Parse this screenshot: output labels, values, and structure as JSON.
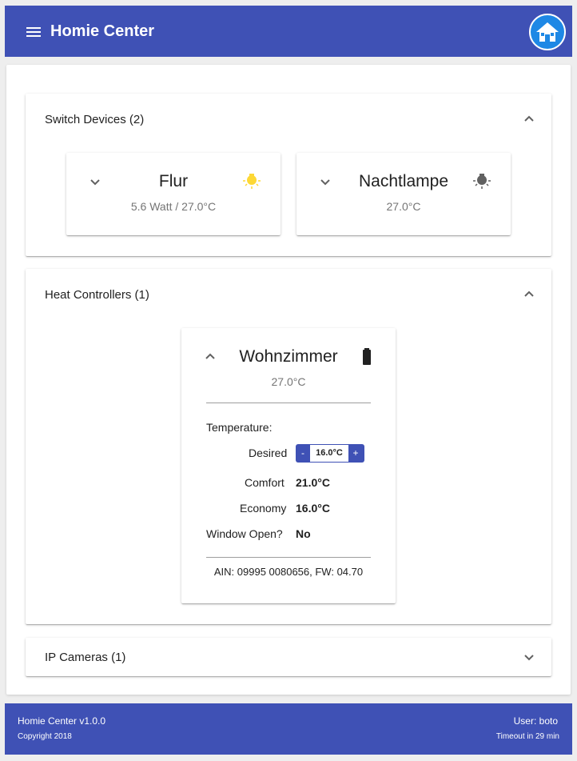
{
  "app": {
    "title": "Homie Center"
  },
  "colors": {
    "primary": "#3f51b5",
    "bulb_on": "#fdd835",
    "bulb_off": "#616161"
  },
  "panels": {
    "switch": {
      "title": "Switch Devices (2)",
      "expanded": true,
      "devices": [
        {
          "name": "Flur",
          "status": "5.6 Watt / 27.0°C",
          "state_icon": "bulb-on-icon"
        },
        {
          "name": "Nachtlampe",
          "status": "27.0°C",
          "state_icon": "bulb-off-icon"
        }
      ]
    },
    "heat": {
      "title": "Heat Controllers (1)",
      "expanded": true,
      "device": {
        "name": "Wohnzimmer",
        "status": "27.0°C",
        "battery_icon": "battery-icon",
        "temperature_label": "Temperature:",
        "desired_label": "Desired",
        "desired_value": "16.0°C",
        "dec_label": "-",
        "inc_label": "+",
        "comfort_label": "Comfort",
        "comfort_value": "21.0°C",
        "economy_label": "Economy",
        "economy_value": "16.0°C",
        "window_label": "Window Open?",
        "window_value": "No",
        "ain_fw": "AIN: 09995 0080656, FW: 04.70"
      }
    },
    "cameras": {
      "title": "IP Cameras (1)",
      "expanded": false
    }
  },
  "footer": {
    "version": "Homie Center v1.0.0",
    "copyright": "Copyright 2018",
    "user": "User: boto",
    "timeout": "Timeout in 29 min"
  }
}
